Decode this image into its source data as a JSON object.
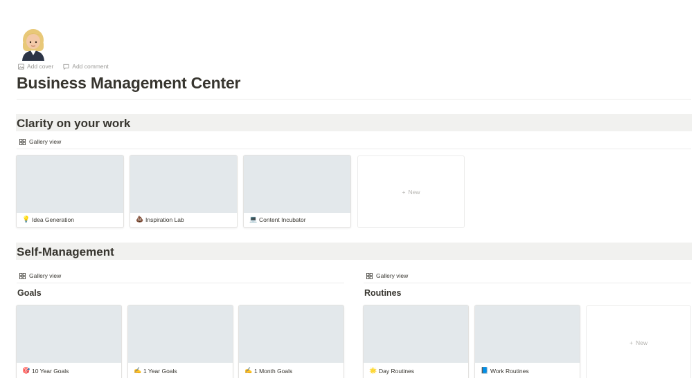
{
  "page": {
    "icon": "woman-office-worker-emoji",
    "title": "Business Management Center",
    "add_cover": "Add cover",
    "add_comment": "Add comment"
  },
  "sections": {
    "clarity": {
      "title": "Clarity on your work",
      "view_label": "Gallery view",
      "cards": [
        {
          "emoji": "💡",
          "label": "Idea Generation"
        },
        {
          "emoji": "💩",
          "label": "Inspiration Lab"
        },
        {
          "emoji": "💻",
          "label": "Content Incubator"
        }
      ],
      "new_label": "New"
    },
    "self_management": {
      "title": "Self-Management",
      "goals": {
        "view_label": "Gallery view",
        "title": "Goals",
        "cards": [
          {
            "emoji": "🎯",
            "label": "10 Year Goals"
          },
          {
            "emoji": "✍️",
            "label": "1 Year Goals"
          },
          {
            "emoji": "✍️",
            "label": "1 Month Goals"
          }
        ]
      },
      "routines": {
        "view_label": "Gallery view",
        "title": "Routines",
        "cards": [
          {
            "emoji": "🌟",
            "label": "Day Routines"
          },
          {
            "emoji": "📘",
            "label": "Work Routines"
          }
        ],
        "new_label": "New"
      }
    }
  },
  "colors": {
    "text": "#37352f",
    "muted": "#9b9a97",
    "band": "#f1f1ef",
    "cover": "#e3e8eb",
    "border": "#e3e2e0"
  }
}
